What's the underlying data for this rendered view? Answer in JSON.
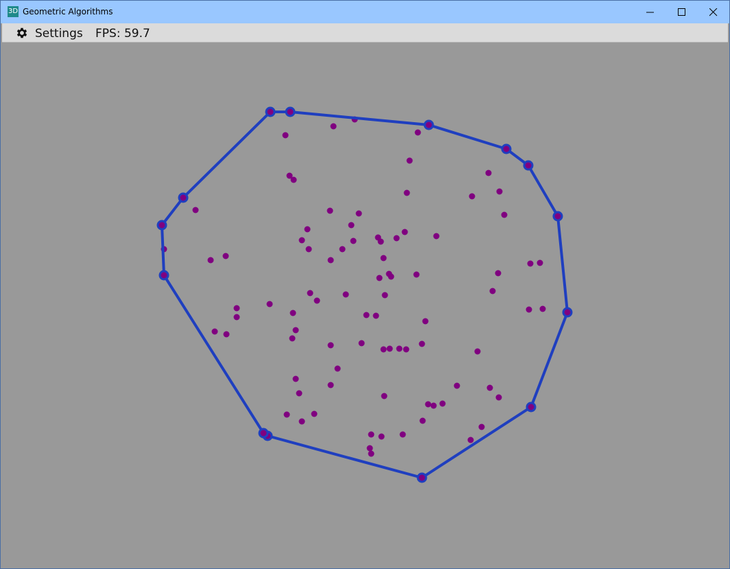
{
  "window": {
    "title": "Geometric Algorithms",
    "icon_label": "3D",
    "controls": [
      "minimize-icon",
      "maximize-icon",
      "close-icon"
    ]
  },
  "menubar": {
    "settings_label": "Settings",
    "settings_icon": "gear-icon",
    "fps_text": "FPS: 59.7"
  },
  "colors": {
    "background": "#999999",
    "point": "#800080",
    "hull": "#1f3fbf"
  }
}
